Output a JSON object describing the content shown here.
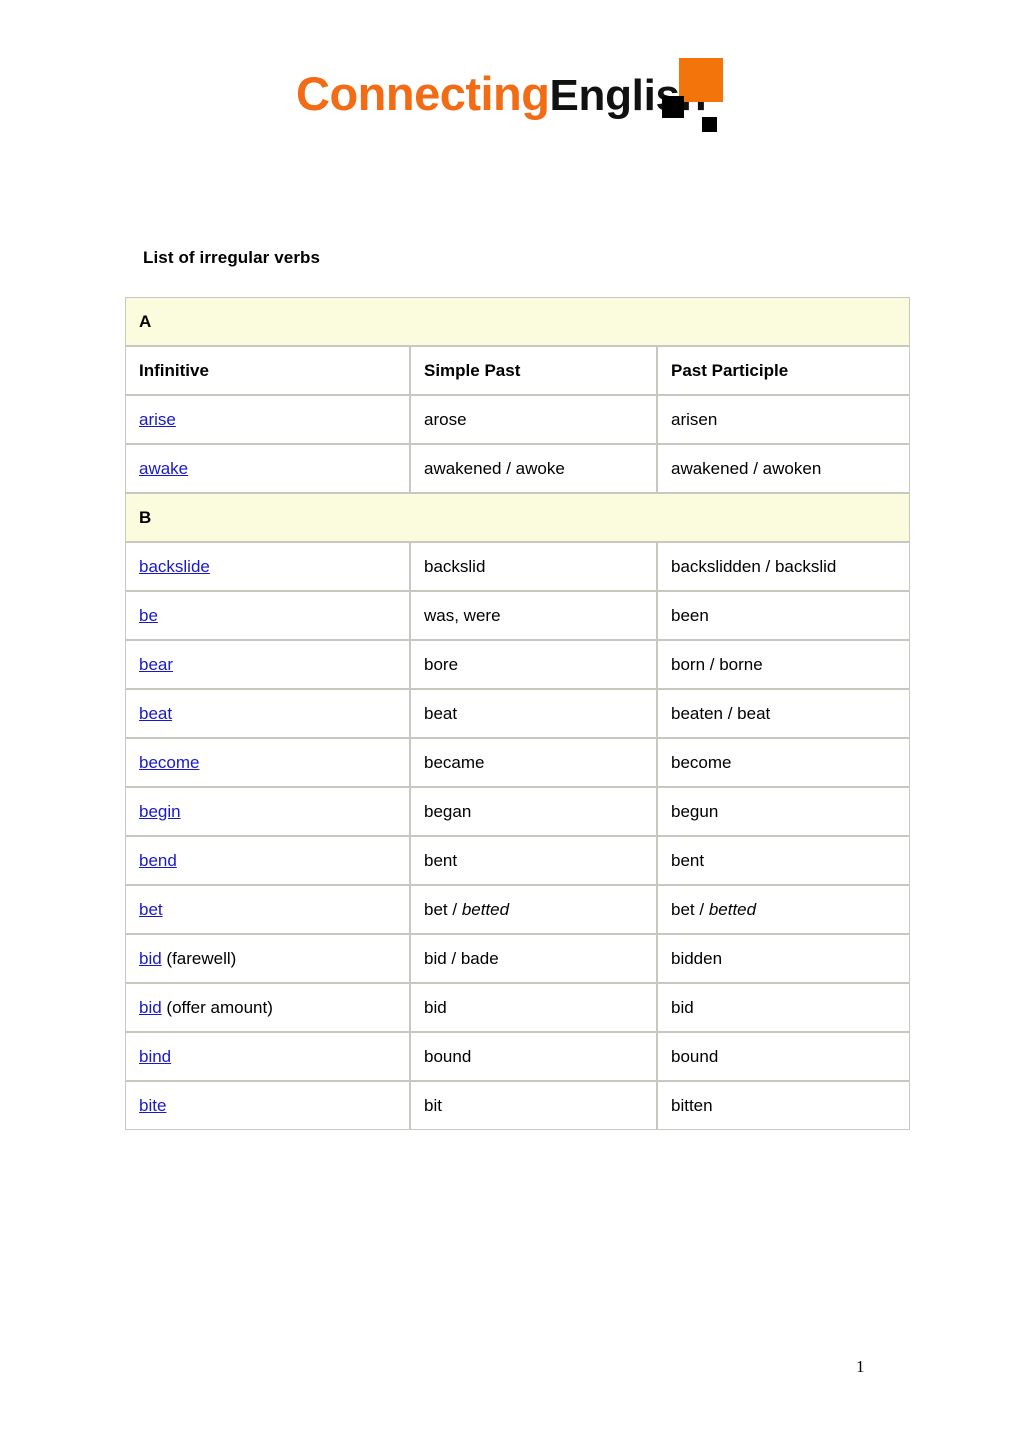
{
  "logo": {
    "part_one": "Connecting",
    "part_two": "English",
    "orange_hex": "#F2740B",
    "black_hex": "#000000"
  },
  "document": {
    "title": "List of irregular verbs",
    "page_number": "1"
  },
  "table": {
    "columns": [
      "Infinitive",
      "Simple Past",
      "Past Participle"
    ],
    "sections": [
      {
        "letter": "A",
        "show_header": true,
        "rows": [
          {
            "infinitive": "arise",
            "note": "",
            "simple_past": "arose",
            "simple_past_alt": "",
            "past_participle": "arisen",
            "past_participle_alt": ""
          },
          {
            "infinitive": "awake",
            "note": "",
            "simple_past": "awakened / awoke",
            "simple_past_alt": "",
            "past_participle": "awakened / awoken",
            "past_participle_alt": ""
          }
        ]
      },
      {
        "letter": "B",
        "show_header": false,
        "rows": [
          {
            "infinitive": "backslide",
            "note": "",
            "simple_past": "backslid",
            "simple_past_alt": "",
            "past_participle": "backslidden / backslid",
            "past_participle_alt": ""
          },
          {
            "infinitive": "be",
            "note": "",
            "simple_past": "was, were",
            "simple_past_alt": "",
            "past_participle": "been",
            "past_participle_alt": ""
          },
          {
            "infinitive": "bear",
            "note": "",
            "simple_past": "bore",
            "simple_past_alt": "",
            "past_participle": "born / borne",
            "past_participle_alt": ""
          },
          {
            "infinitive": "beat",
            "note": "",
            "simple_past": "beat",
            "simple_past_alt": "",
            "past_participle": "beaten / beat",
            "past_participle_alt": ""
          },
          {
            "infinitive": "become",
            "note": "",
            "simple_past": "became",
            "simple_past_alt": "",
            "past_participle": "become",
            "past_participle_alt": ""
          },
          {
            "infinitive": "begin",
            "note": "",
            "simple_past": "began",
            "simple_past_alt": "",
            "past_participle": "begun",
            "past_participle_alt": ""
          },
          {
            "infinitive": "bend",
            "note": "",
            "simple_past": "bent",
            "simple_past_alt": "",
            "past_participle": "bent",
            "past_participle_alt": ""
          },
          {
            "infinitive": "bet",
            "note": "",
            "simple_past": "bet / ",
            "simple_past_alt": "betted",
            "past_participle": "bet / ",
            "past_participle_alt": "betted"
          },
          {
            "infinitive": "bid",
            "note": " (farewell)",
            "simple_past": "bid / bade",
            "simple_past_alt": "",
            "past_participle": "bidden",
            "past_participle_alt": ""
          },
          {
            "infinitive": "bid",
            "note": " (offer amount)",
            "simple_past": "bid",
            "simple_past_alt": "",
            "past_participle": "bid",
            "past_participle_alt": ""
          },
          {
            "infinitive": "bind",
            "note": "",
            "simple_past": "bound",
            "simple_past_alt": "",
            "past_participle": "bound",
            "past_participle_alt": ""
          },
          {
            "infinitive": "bite",
            "note": "",
            "simple_past": "bit",
            "simple_past_alt": "",
            "past_participle": "bitten",
            "past_participle_alt": ""
          }
        ]
      }
    ]
  }
}
